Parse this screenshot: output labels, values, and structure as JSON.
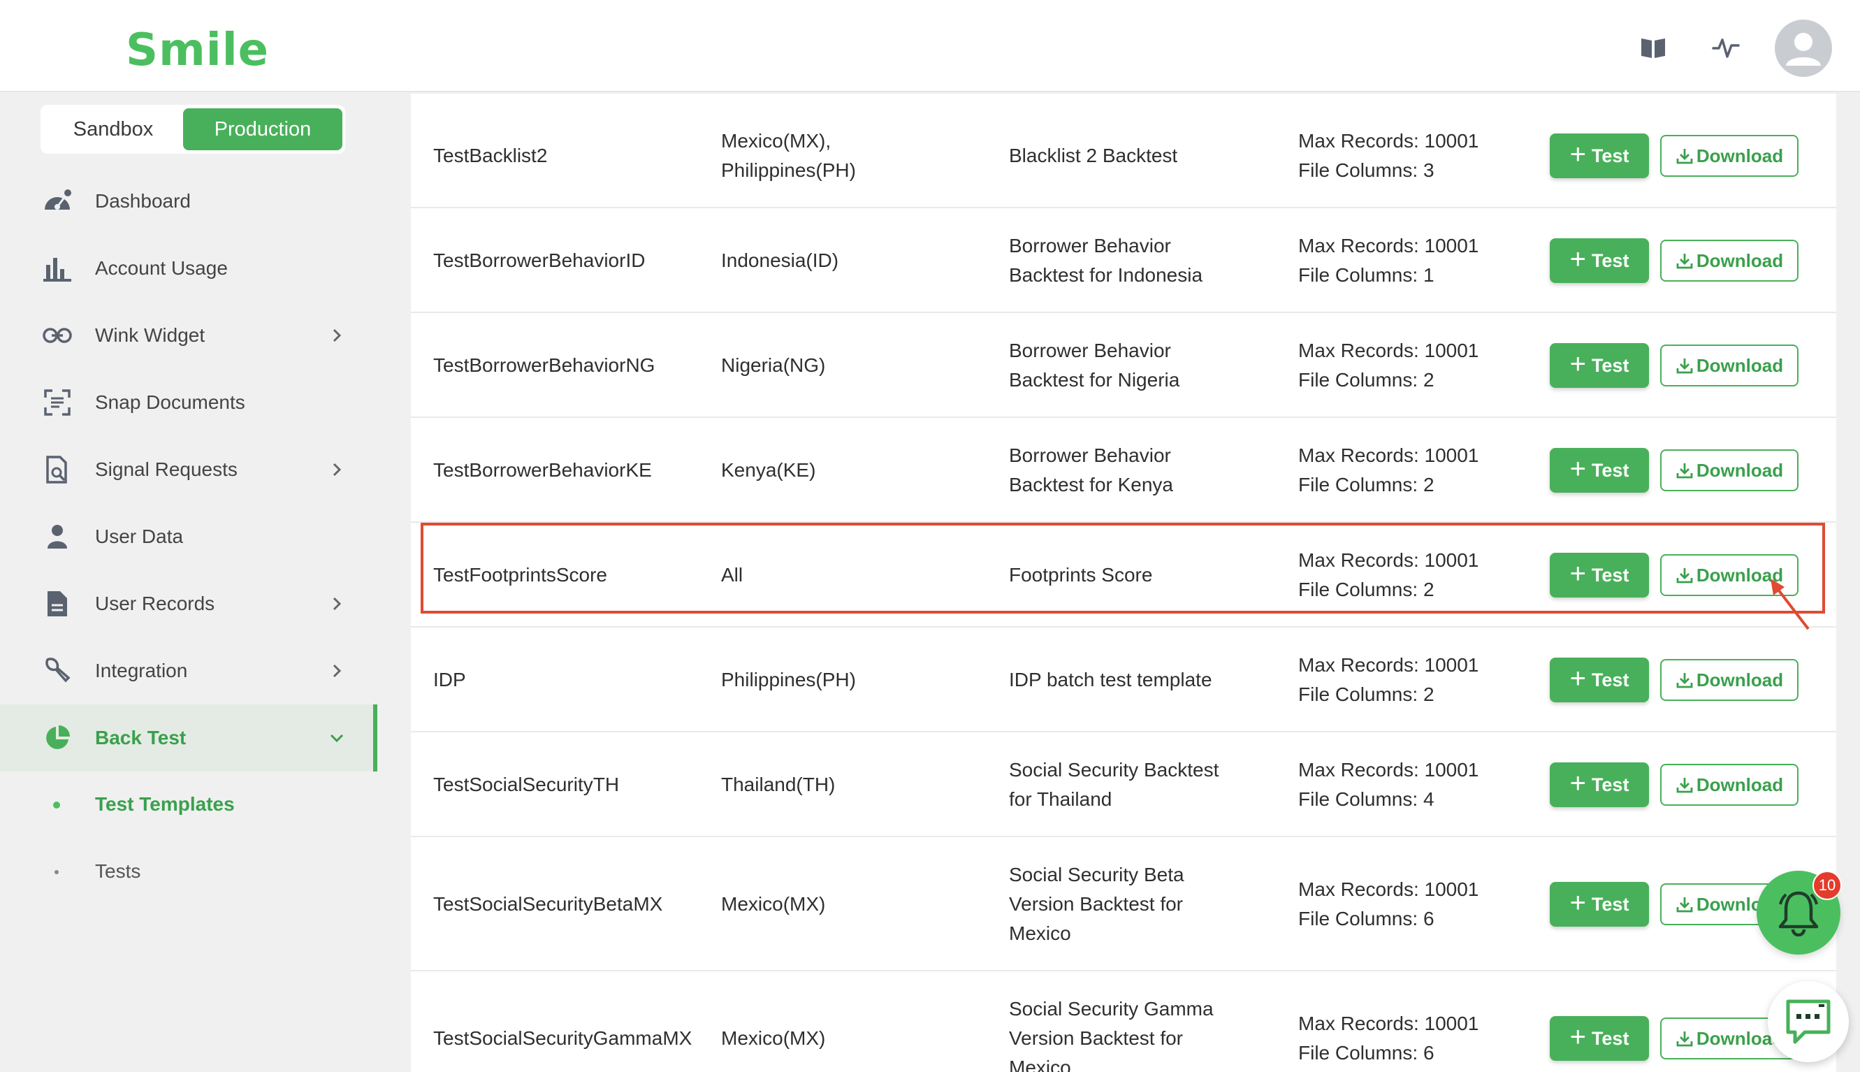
{
  "header": {
    "logo": "Smile",
    "icons": [
      "book-icon",
      "activity-icon",
      "user-avatar-icon"
    ]
  },
  "env_switch": {
    "sandbox": "Sandbox",
    "production": "Production",
    "selected": "Production"
  },
  "sidebar": {
    "items": [
      {
        "label": "Dashboard",
        "icon": "dashboard-icon"
      },
      {
        "label": "Account Usage",
        "icon": "bar-chart-icon"
      },
      {
        "label": "Wink Widget",
        "icon": "link-icon",
        "has_chevron": true
      },
      {
        "label": "Snap Documents",
        "icon": "scan-icon"
      },
      {
        "label": "Signal Requests",
        "icon": "document-search-icon",
        "has_chevron": true
      },
      {
        "label": "User Data",
        "icon": "person-icon"
      },
      {
        "label": "User Records",
        "icon": "file-icon",
        "has_chevron": true
      },
      {
        "label": "Integration",
        "icon": "wrench-icon",
        "has_chevron": true
      },
      {
        "label": "Back Test",
        "icon": "pie-chart-icon",
        "has_chevron": true,
        "expanded": true,
        "active": true
      }
    ],
    "subitems": [
      {
        "label": "Test Templates",
        "active": true
      },
      {
        "label": "Tests"
      }
    ]
  },
  "table": {
    "test_label": "Test",
    "download_label": "Download",
    "rows": [
      {
        "name": "TestBacklist2",
        "country": [
          "Mexico(MX),",
          "Philippines(PH)"
        ],
        "description": [
          "Blacklist 2 Backtest"
        ],
        "info": [
          "Max Records: 10001",
          "File Columns: 3"
        ]
      },
      {
        "name": "TestBorrowerBehaviorID",
        "country": [
          "Indonesia(ID)"
        ],
        "description": [
          "Borrower Behavior",
          "Backtest for Indonesia"
        ],
        "info": [
          "Max Records: 10001",
          "File Columns: 1"
        ]
      },
      {
        "name": "TestBorrowerBehaviorNG",
        "country": [
          "Nigeria(NG)"
        ],
        "description": [
          "Borrower Behavior",
          "Backtest for Nigeria"
        ],
        "info": [
          "Max Records: 10001",
          "File Columns: 2"
        ]
      },
      {
        "name": "TestBorrowerBehaviorKE",
        "country": [
          "Kenya(KE)"
        ],
        "description": [
          "Borrower Behavior",
          "Backtest for Kenya"
        ],
        "info": [
          "Max Records: 10001",
          "File Columns: 2"
        ]
      },
      {
        "name": "TestFootprintsScore",
        "country": [
          "All"
        ],
        "description": [
          "Footprints Score"
        ],
        "info": [
          "Max Records: 10001",
          "File Columns: 2"
        ],
        "highlighted": true
      },
      {
        "name": "IDP",
        "country": [
          "Philippines(PH)"
        ],
        "description": [
          "IDP batch test template"
        ],
        "info": [
          "Max Records: 10001",
          "File Columns: 2"
        ]
      },
      {
        "name": "TestSocialSecurityTH",
        "country": [
          "Thailand(TH)"
        ],
        "description": [
          "Social Security Backtest",
          "for Thailand"
        ],
        "info": [
          "Max Records: 10001",
          "File Columns: 4"
        ]
      },
      {
        "name": "TestSocialSecurityBetaMX",
        "country": [
          "Mexico(MX)"
        ],
        "description": [
          "Social Security Beta",
          "Version Backtest for",
          "Mexico"
        ],
        "info": [
          "Max Records: 10001",
          "File Columns: 6"
        ]
      },
      {
        "name": "TestSocialSecurityGammaMX",
        "country": [
          "Mexico(MX)"
        ],
        "description": [
          "Social Security Gamma",
          "Version Backtest for",
          "Mexico"
        ],
        "info": [
          "Max Records: 10001",
          "File Columns: 6"
        ]
      }
    ]
  },
  "notifications": {
    "count": "10",
    "icon": "bell-icon"
  },
  "chat": {
    "icon": "chat-icon"
  },
  "colors": {
    "brand_green": "#48b05a",
    "highlight_red": "#e04b32",
    "badge_red": "#e43b2c"
  }
}
